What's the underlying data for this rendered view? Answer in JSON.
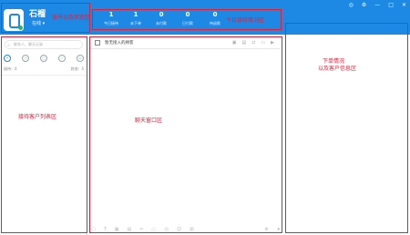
{
  "account": {
    "name": "石榴",
    "status": "在线 ▾"
  },
  "stats": [
    {
      "value": "1",
      "label": "今日接待"
    },
    {
      "value": "1",
      "label": "未下单"
    },
    {
      "value": "0",
      "label": "未付款"
    },
    {
      "value": "0",
      "label": "已付款"
    },
    {
      "value": "0",
      "label": "待退款"
    }
  ],
  "window_controls": [
    "◎",
    "⚙",
    "—",
    "□",
    "✕"
  ],
  "annotations": {
    "account_area": "账号以及状态区",
    "today_stats": "今日接待情况区",
    "customer_list": "接待客户列表区",
    "chat_window": "聊天窗口区",
    "order_info": "下单情况",
    "customer_info": "以及客户信息区"
  },
  "left_panel": {
    "search_placeholder": "联系人、聊天记录",
    "tab_icons": [
      "chat-icon",
      "clock-icon",
      "contacts-icon",
      "star-icon",
      "group-icon"
    ],
    "visitors_label": "接待：0",
    "others_label": "其他：5"
  },
  "chat": {
    "header_title": "暂无接入的顾客",
    "header_icons": [
      "image-icon",
      "file-icon",
      "transfer-icon",
      "desktop-icon",
      "video-icon"
    ],
    "footer_icons": [
      "screenshot-icon",
      "text-icon",
      "picture-icon",
      "file-icon",
      "scissor-icon",
      "info-icon",
      "history-icon",
      "emoji-icon",
      "quick-reply-icon",
      "settings-icon",
      "send-icon"
    ]
  },
  "right_panel": {
    "toolbar_icons": [
      "refresh-icon",
      "add-icon"
    ]
  },
  "colors": {
    "brand_blue": "#1e88e5",
    "annotation_red": "#e0203a",
    "online_green": "#2db84d"
  }
}
